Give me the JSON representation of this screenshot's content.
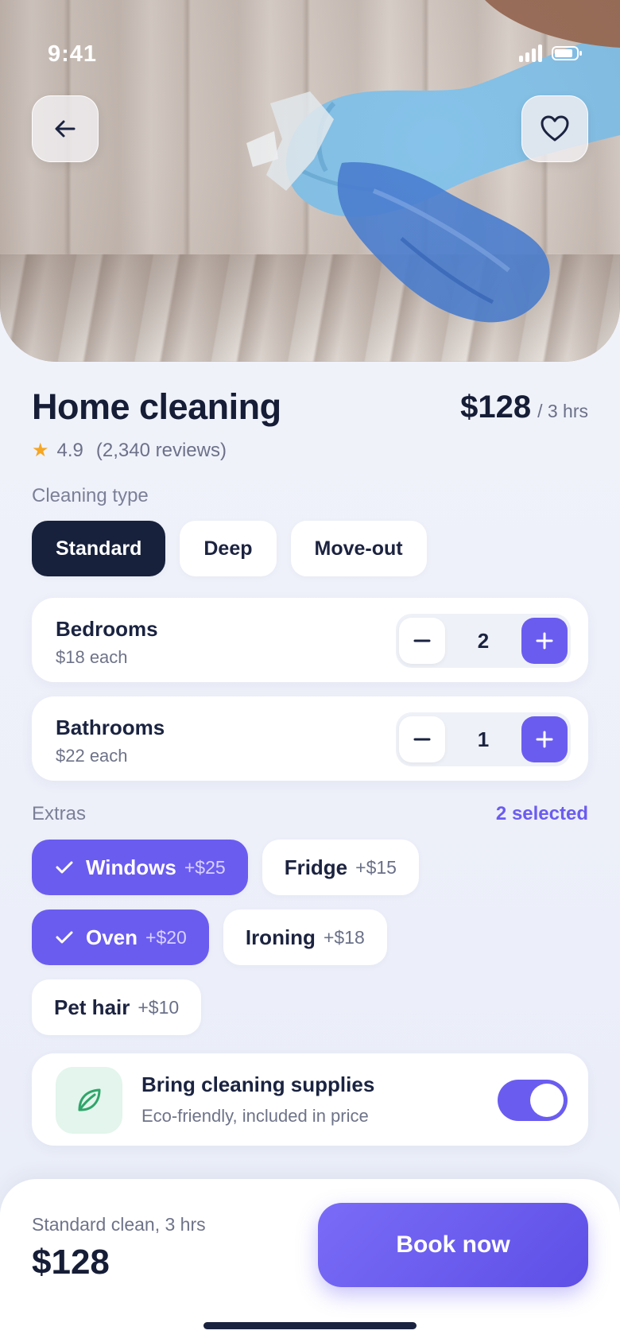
{
  "status": {
    "time": "9:41"
  },
  "hero": {
    "image_alt": "Gloved hand holding blue spray bottle"
  },
  "service": {
    "title": "Home cleaning",
    "price": "$128",
    "price_unit": "/ 3 hrs",
    "rating": "4.9",
    "reviews": "(2,340 reviews)"
  },
  "cleaning_type": {
    "label": "Cleaning type",
    "options": [
      "Standard",
      "Deep",
      "Move-out"
    ],
    "selected": "Standard"
  },
  "rooms": [
    {
      "title": "Bedrooms",
      "sub": "$18 each",
      "value": "2"
    },
    {
      "title": "Bathrooms",
      "sub": "$22 each",
      "value": "1"
    }
  ],
  "extras": {
    "label": "Extras",
    "selected_count": "2 selected",
    "items": [
      {
        "name": "Windows",
        "cost": "+$25",
        "selected": true
      },
      {
        "name": "Fridge",
        "cost": "+$15",
        "selected": false
      },
      {
        "name": "Oven",
        "cost": "+$20",
        "selected": true
      },
      {
        "name": "Ironing",
        "cost": "+$18",
        "selected": false
      },
      {
        "name": "Pet hair",
        "cost": "+$10",
        "selected": false
      }
    ]
  },
  "supplies": {
    "title": "Bring cleaning supplies",
    "sub": "Eco-friendly, included in price",
    "enabled": true
  },
  "footer": {
    "summary": "Standard clean, 3 hrs",
    "total": "$128",
    "cta": "Book now"
  },
  "colors": {
    "accent": "#6b5cf0",
    "dark": "#17213c",
    "eco_bg": "#e3f5ec",
    "eco_icon": "#2fa56a",
    "star": "#f5a623"
  }
}
